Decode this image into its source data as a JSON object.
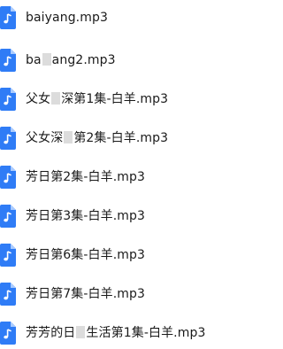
{
  "files": [
    {
      "name_before": "baiyang.mp3",
      "name_after": "",
      "redacted": false,
      "icon": "audio-file-icon"
    },
    {
      "name_before": "ba",
      "name_after": "ang2.mp3",
      "redacted": true,
      "icon": "audio-file-icon"
    },
    {
      "name_before": "父女",
      "name_after": "深第1集-白羊.mp3",
      "redacted": true,
      "icon": "audio-file-icon"
    },
    {
      "name_before": "父女深",
      "name_after": "第2集-白羊.mp3",
      "redacted": true,
      "icon": "audio-file-icon"
    },
    {
      "name_before": "芳日第2集-白羊.mp3",
      "name_after": "",
      "redacted": false,
      "icon": "audio-file-icon"
    },
    {
      "name_before": "芳日第3集-白羊.mp3",
      "name_after": "",
      "redacted": false,
      "icon": "audio-file-icon"
    },
    {
      "name_before": "芳日第6集-白羊.mp3",
      "name_after": "",
      "redacted": false,
      "icon": "audio-file-icon"
    },
    {
      "name_before": "芳日第7集-白羊.mp3",
      "name_after": "",
      "redacted": false,
      "icon": "audio-file-icon"
    },
    {
      "name_before": "芳芳的日",
      "name_after": "生活第1集-白羊.mp3",
      "redacted": true,
      "icon": "audio-file-icon"
    }
  ],
  "colors": {
    "icon_blue": "#2f7cf6",
    "icon_fold": "#a9cbff",
    "text": "#1a1a1a"
  }
}
